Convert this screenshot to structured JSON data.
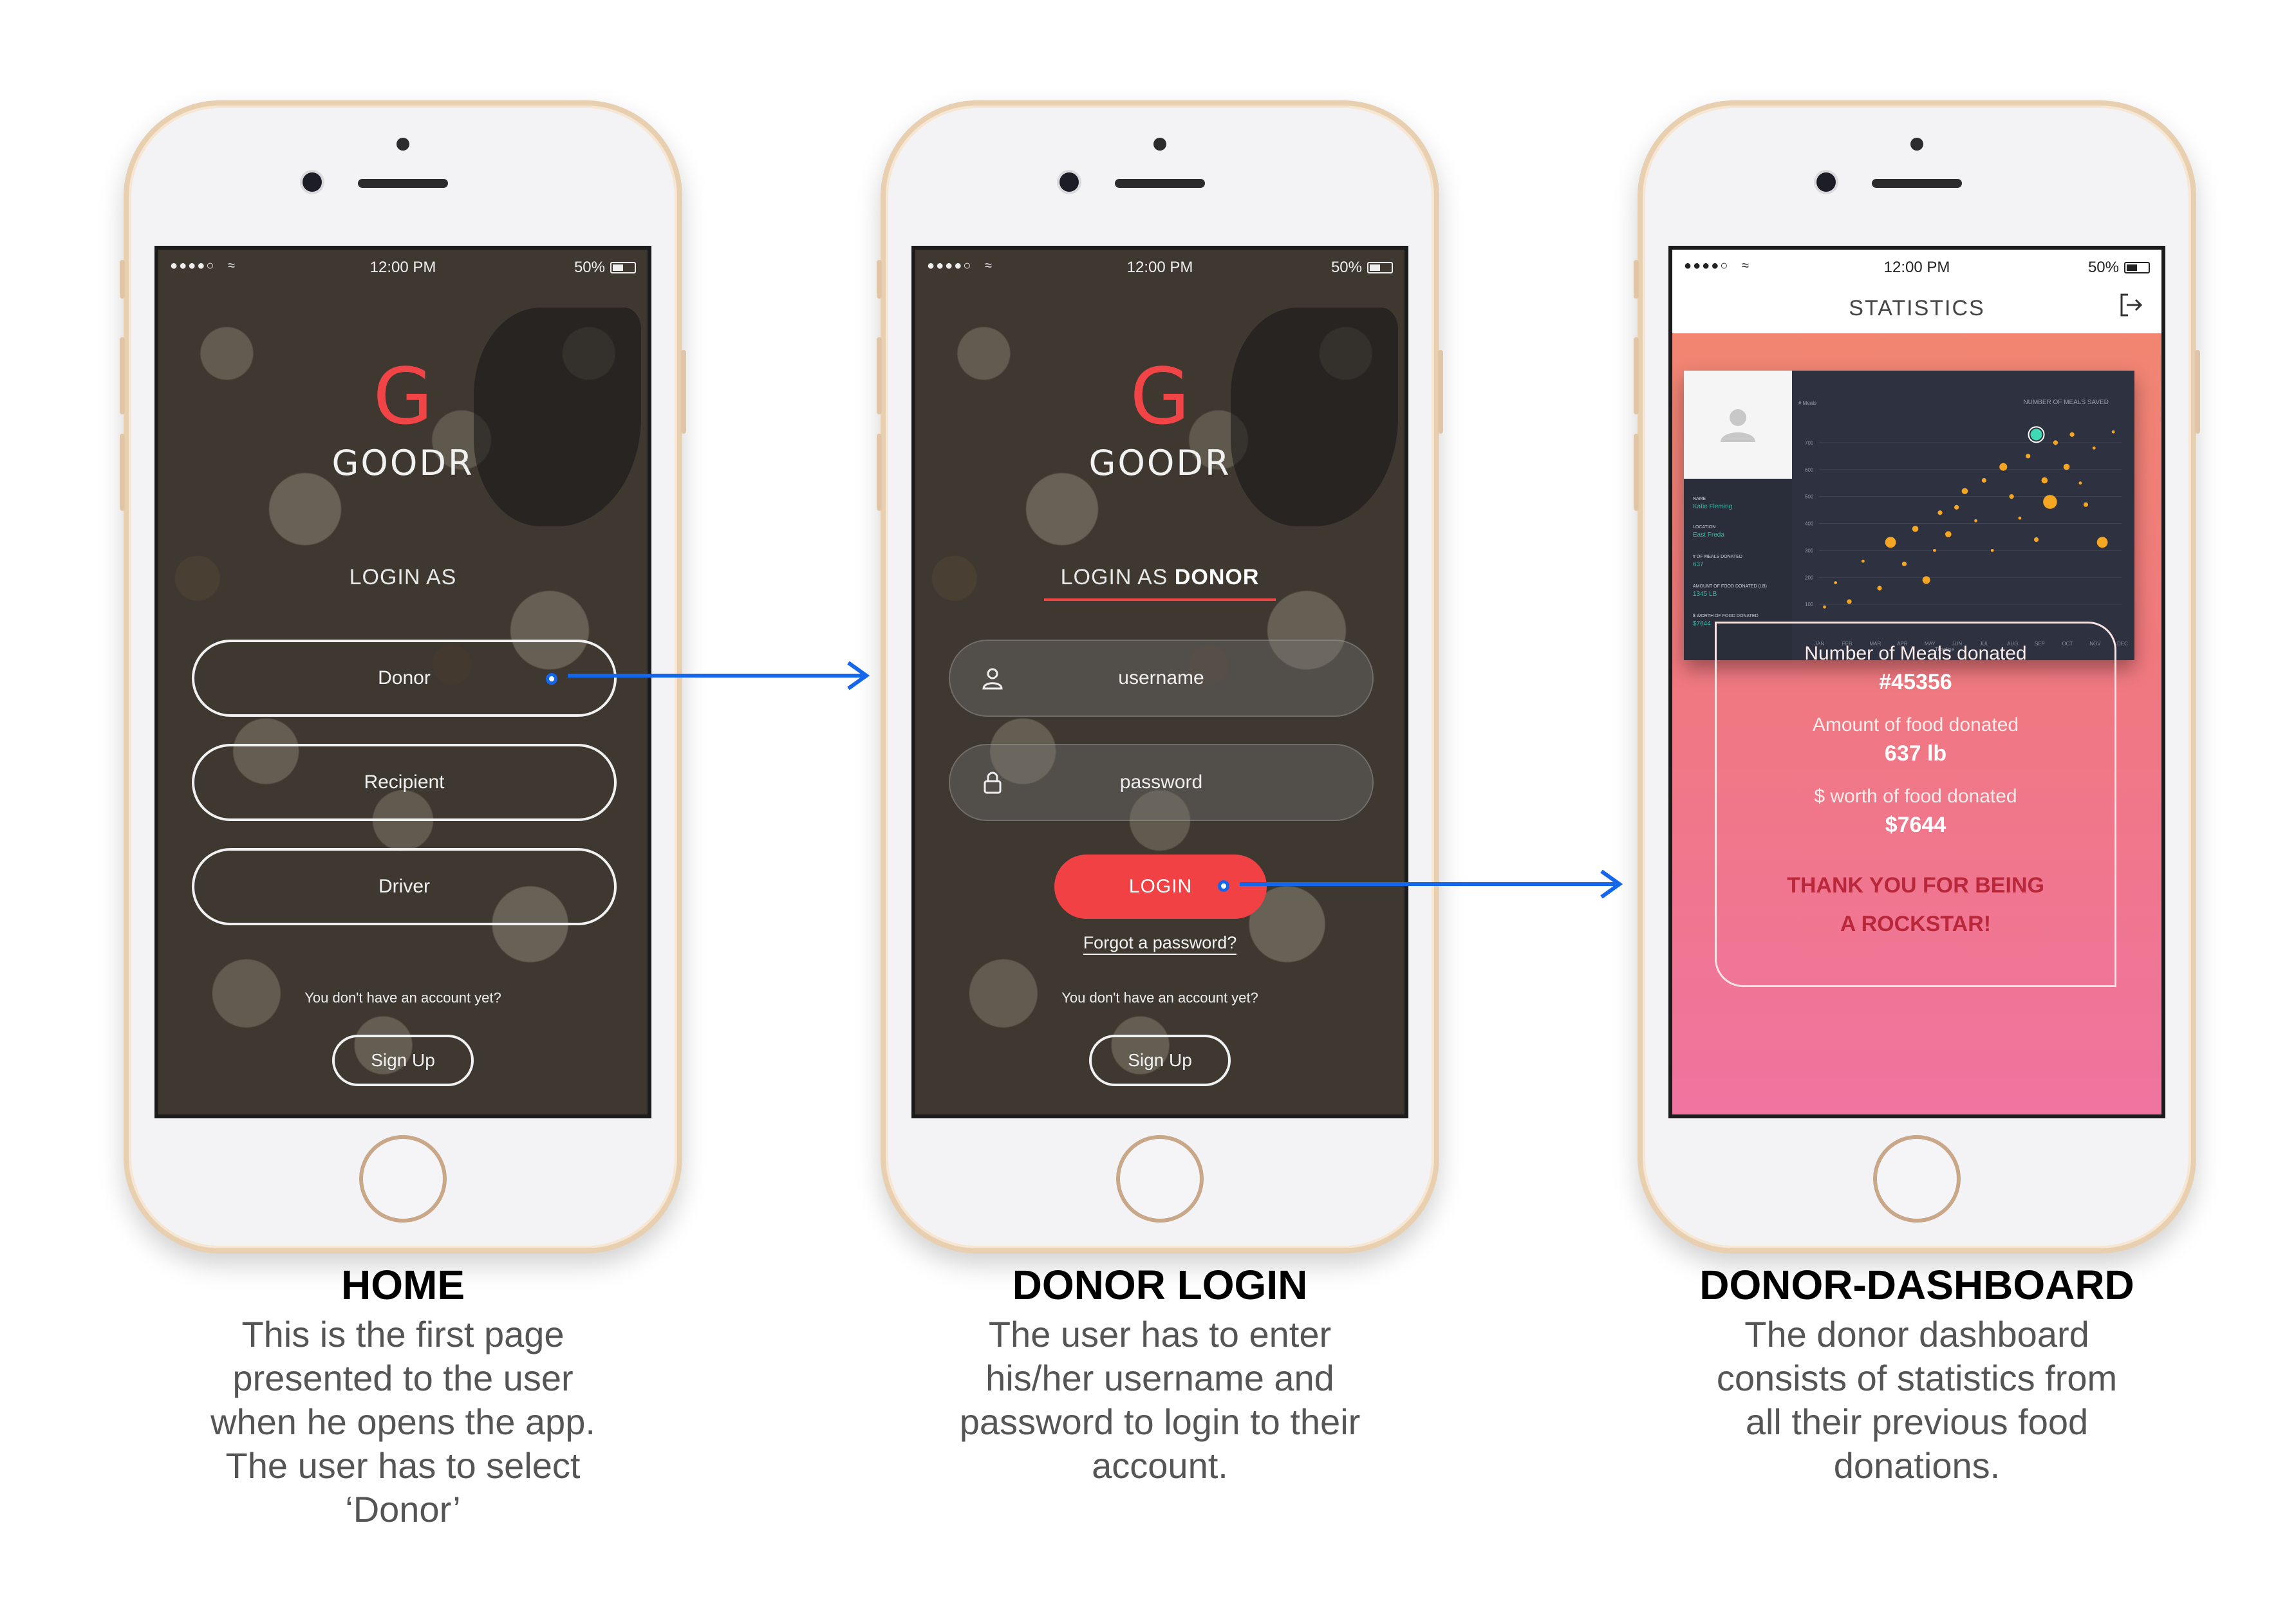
{
  "status": {
    "time": "12:00 PM",
    "battery": "50%",
    "signal": "●●●●○",
    "wifi": "≈"
  },
  "brand": {
    "letter": "G",
    "name": "GOODR",
    "accent": "#f04447"
  },
  "home": {
    "login_as": "LOGIN AS",
    "options": [
      "Donor",
      "Recipient",
      "Driver"
    ],
    "no_account": "You don't have an account yet?",
    "signup": "Sign Up"
  },
  "donor_login": {
    "login_as_prefix": "LOGIN AS ",
    "login_as_role": "DONOR",
    "username_placeholder": "username",
    "password_placeholder": "password",
    "login": "LOGIN",
    "forgot": "Forgot a password?",
    "no_account": "You don't have an account yet?",
    "signup": "Sign Up"
  },
  "dashboard": {
    "title": "STATISTICS",
    "profile": {
      "name_label": "NAME",
      "name": "Katie Fleming",
      "location_label": "LOCATION",
      "location": "East Freda",
      "meals_label": "# OF MEALS DONATED",
      "meals": "637",
      "amount_label": "AMOUNT OF FOOD DONATED (LB)",
      "amount": "1345 LB",
      "worth_label": "$ WORTH OF FOOD DONATED",
      "worth": "$7644"
    },
    "summary": {
      "meals_label": "Number of Meals donated",
      "meals_value": "#45356",
      "food_label": "Amount of food donated",
      "food_value": "637 lb",
      "worth_label": "$ worth of food donated",
      "worth_value": "$7644",
      "thanks_line1": "THANK YOU FOR BEING",
      "thanks_line2": "A ROCKSTAR!"
    }
  },
  "chart_data": {
    "type": "scatter",
    "title": "NUMBER OF MEALS SAVED",
    "xlabel": "Timeline",
    "ylabel": "# Meals",
    "categories": [
      "JAN",
      "FEB",
      "MAR",
      "APR",
      "MAY",
      "JUN",
      "JUL",
      "AUG",
      "SEP",
      "OCT",
      "NOV",
      "DEC"
    ],
    "yticks": [
      100,
      200,
      300,
      400,
      500,
      600,
      700
    ],
    "ylim": [
      0,
      800
    ],
    "grid": true,
    "points": [
      {
        "x": 0.2,
        "y": 90,
        "r": 2
      },
      {
        "x": 0.6,
        "y": 180,
        "r": 2
      },
      {
        "x": 1.1,
        "y": 110,
        "r": 3
      },
      {
        "x": 1.6,
        "y": 260,
        "r": 2
      },
      {
        "x": 2.2,
        "y": 160,
        "r": 3
      },
      {
        "x": 2.6,
        "y": 330,
        "r": 7
      },
      {
        "x": 3.1,
        "y": 250,
        "r": 3
      },
      {
        "x": 3.5,
        "y": 380,
        "r": 4
      },
      {
        "x": 3.9,
        "y": 190,
        "r": 5
      },
      {
        "x": 4.2,
        "y": 300,
        "r": 2
      },
      {
        "x": 4.4,
        "y": 440,
        "r": 3
      },
      {
        "x": 4.7,
        "y": 360,
        "r": 4
      },
      {
        "x": 5.0,
        "y": 460,
        "r": 3
      },
      {
        "x": 5.3,
        "y": 520,
        "r": 4
      },
      {
        "x": 5.7,
        "y": 410,
        "r": 2
      },
      {
        "x": 6.0,
        "y": 560,
        "r": 3
      },
      {
        "x": 6.3,
        "y": 300,
        "r": 2
      },
      {
        "x": 6.7,
        "y": 610,
        "r": 5
      },
      {
        "x": 7.0,
        "y": 500,
        "r": 3
      },
      {
        "x": 7.3,
        "y": 420,
        "r": 2
      },
      {
        "x": 7.6,
        "y": 650,
        "r": 3
      },
      {
        "x": 7.9,
        "y": 340,
        "r": 3
      },
      {
        "x": 8.2,
        "y": 560,
        "r": 4
      },
      {
        "x": 8.4,
        "y": 480,
        "r": 9
      },
      {
        "x": 8.6,
        "y": 700,
        "r": 3
      },
      {
        "x": 9.0,
        "y": 610,
        "r": 4
      },
      {
        "x": 9.2,
        "y": 730,
        "r": 3
      },
      {
        "x": 9.5,
        "y": 550,
        "r": 2
      },
      {
        "x": 9.7,
        "y": 470,
        "r": 3
      },
      {
        "x": 10.0,
        "y": 680,
        "r": 2
      },
      {
        "x": 10.3,
        "y": 330,
        "r": 7
      },
      {
        "x": 10.7,
        "y": 740,
        "r": 2
      }
    ],
    "highlight": {
      "x": 7.9,
      "y": 730
    },
    "colors": {
      "point": "#f5a623",
      "highlight": "#3ed9b5",
      "background": "#2e3240"
    }
  },
  "captions": [
    {
      "title": "HOME",
      "desc": "This is the first page presented to the user when he opens the app. The user has to select ‘Donor’"
    },
    {
      "title": "DONOR LOGIN",
      "desc": "The user has to enter his/her username and password to login to their account."
    },
    {
      "title": "DONOR-DASHBOARD",
      "desc": "The donor dashboard consists of statistics from all their previous food donations."
    }
  ],
  "colors": {
    "arrow": "#1467ea",
    "login_button": "#f24144"
  }
}
